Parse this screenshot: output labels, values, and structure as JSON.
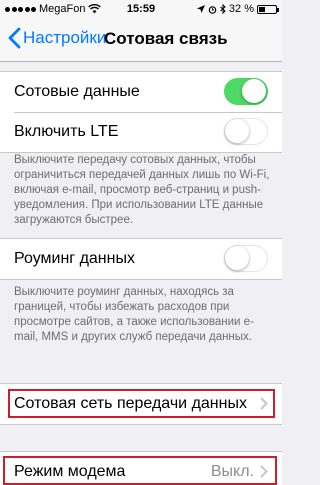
{
  "status_bar": {
    "carrier": "MegaFon",
    "time": "15:59",
    "battery_percent": "32 %",
    "battery_level": 0.32
  },
  "nav": {
    "back_label": "Настройки",
    "title": "Сотовая связь"
  },
  "group1": {
    "cellular_data_label": "Сотовые данные",
    "cellular_data_on": true,
    "lte_label": "Включить LTE",
    "lte_on": false
  },
  "note1": "Выключите передачу сотовых данных, чтобы ограничиться передачей данных лишь по Wi-Fi, включая e-mail, просмотр веб-страниц и push-уведомления. При использовании LTE данные загружаются быстрее.",
  "group2": {
    "roaming_label": "Роуминг данных",
    "roaming_on": false
  },
  "note2": "Выключите роуминг данных, находясь за границей, чтобы избежать расходов при просмотре сайтов, а также использовании e-mail, MMS и других служб передачи данных.",
  "group3": {
    "cellular_network_label": "Сотовая сеть передачи данных"
  },
  "group4": {
    "modem_label": "Режим модема",
    "modem_value": "Выкл."
  },
  "colors": {
    "accent": "#007aff",
    "toggle_on": "#4cd964",
    "highlight": "#d01c2b"
  }
}
